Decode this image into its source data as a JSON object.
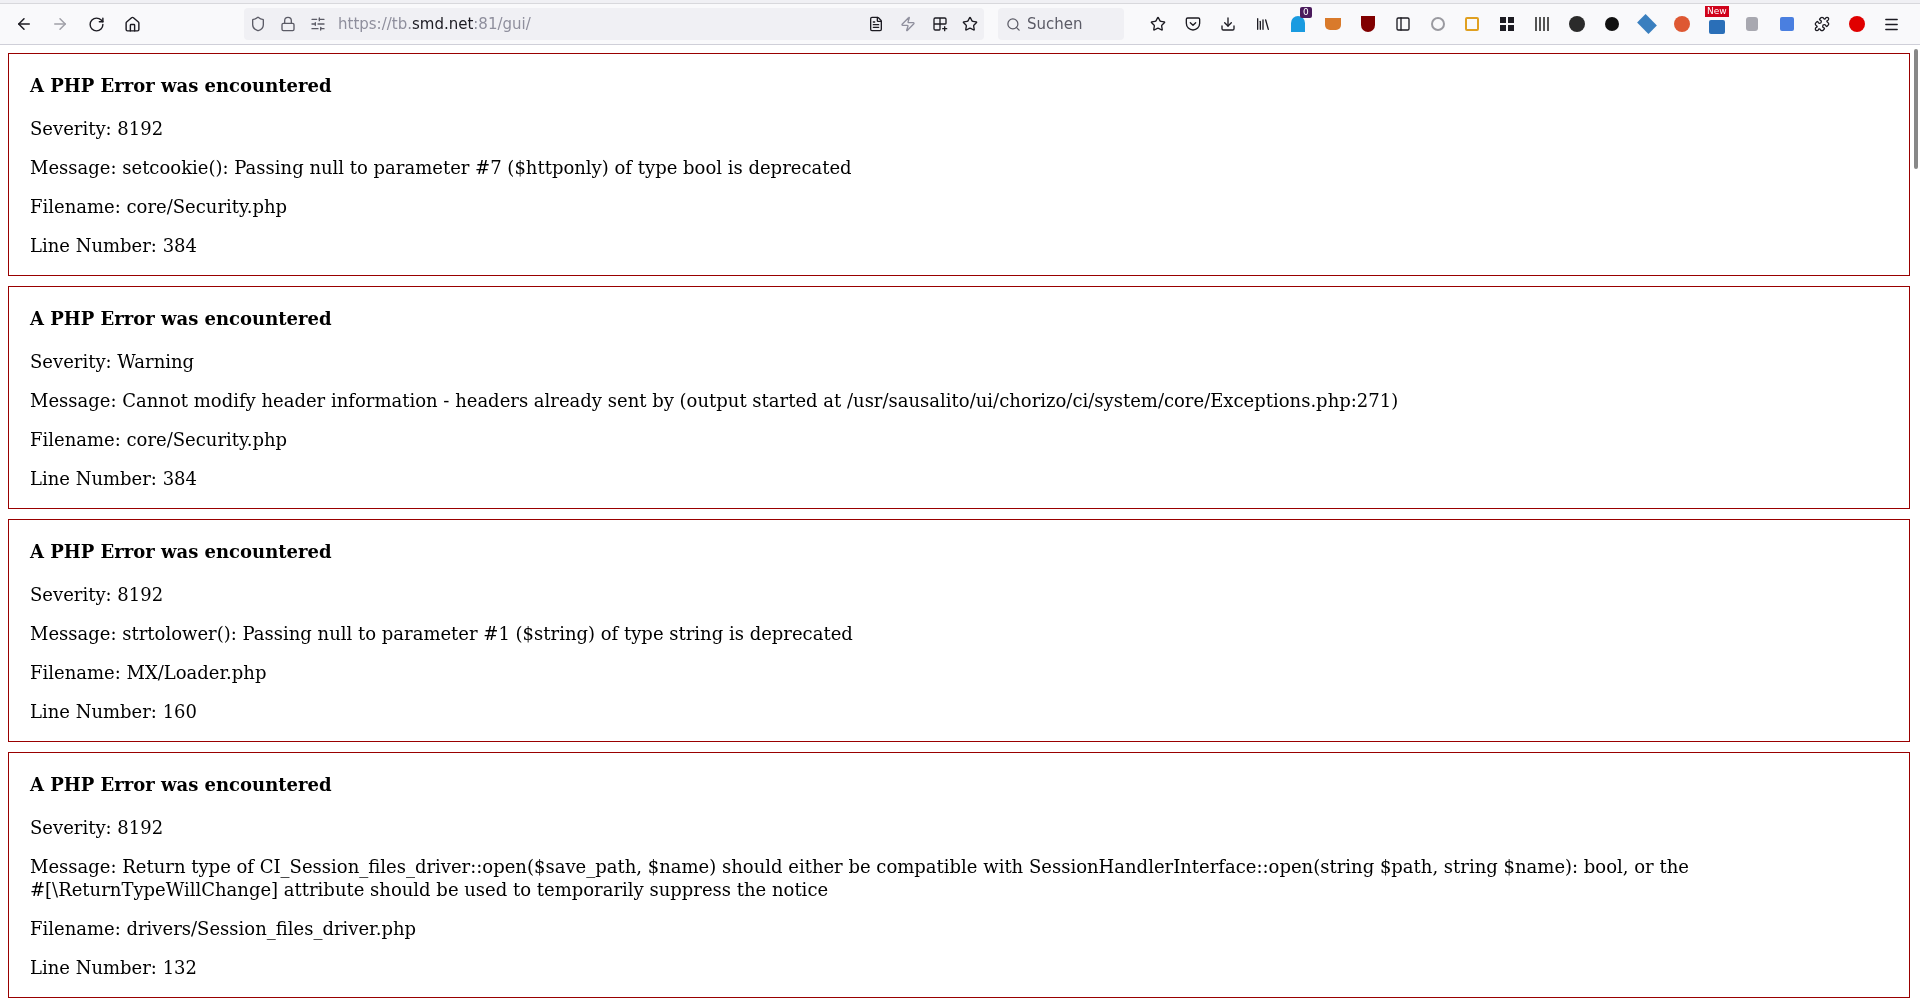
{
  "browser": {
    "url_scheme": "https://tb.",
    "url_host": "smd.net",
    "url_rest": ":81/gui/",
    "search_placeholder": "Suchen",
    "extension_badges": [
      {
        "kind": "count",
        "text": "0"
      },
      {
        "kind": "new",
        "text": "New"
      }
    ]
  },
  "errors": [
    {
      "title": "A PHP Error was encountered",
      "lines": [
        "Severity: 8192",
        "Message: setcookie(): Passing null to parameter #7 ($httponly) of type bool is deprecated",
        "Filename: core/Security.php",
        "Line Number: 384"
      ]
    },
    {
      "title": "A PHP Error was encountered",
      "lines": [
        "Severity: Warning",
        "Message: Cannot modify header information - headers already sent by (output started at /usr/sausalito/ui/chorizo/ci/system/core/Exceptions.php:271)",
        "Filename: core/Security.php",
        "Line Number: 384"
      ]
    },
    {
      "title": "A PHP Error was encountered",
      "lines": [
        "Severity: 8192",
        "Message: strtolower(): Passing null to parameter #1 ($string) of type string is deprecated",
        "Filename: MX/Loader.php",
        "Line Number: 160"
      ]
    },
    {
      "title": "A PHP Error was encountered",
      "lines": [
        "Severity: 8192",
        "Message: Return type of CI_Session_files_driver::open($save_path, $name) should either be compatible with SessionHandlerInterface::open(string $path, string $name): bool, or the #[\\ReturnTypeWillChange] attribute should be used to temporarily suppress the notice",
        "Filename: drivers/Session_files_driver.php",
        "Line Number: 132"
      ]
    }
  ]
}
